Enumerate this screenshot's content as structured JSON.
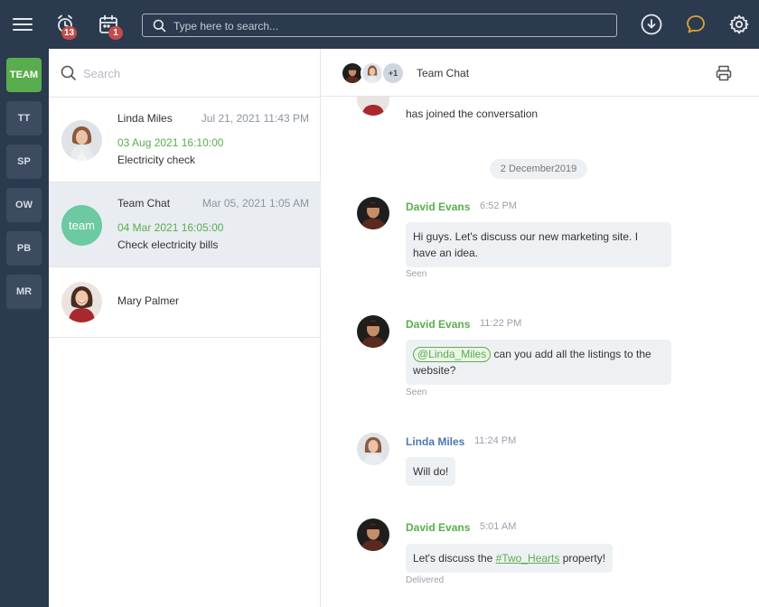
{
  "topbar": {
    "alarm_badge": "13",
    "calendar_badge": "1",
    "search_placeholder": "Type here to search..."
  },
  "rail": {
    "items": [
      {
        "label": "TEAM",
        "active": true
      },
      {
        "label": "TT"
      },
      {
        "label": "SP"
      },
      {
        "label": "OW"
      },
      {
        "label": "PB"
      },
      {
        "label": "MR"
      }
    ]
  },
  "list": {
    "search_placeholder": "Search",
    "conversations": [
      {
        "name": "Linda Miles",
        "time": "Jul 21, 2021 11:43 PM",
        "date": "03 Aug 2021 16:10:00",
        "preview": "Electricity check"
      },
      {
        "name": "Team Chat",
        "time": "Mar 05, 2021 1:05 AM",
        "date": "04 Mar 2021 16:05:00",
        "preview": "Check electricity bills",
        "avatar_text": "team"
      },
      {
        "name": "Mary Palmer"
      }
    ]
  },
  "chat": {
    "title": "Team Chat",
    "extra_members": "+1",
    "join_text": "has joined the conversation",
    "date_divider": "2 December2019",
    "messages": [
      {
        "author": "David Evans",
        "time": "6:52 PM",
        "text_line1": "Hi guys. Let's discuss our new marketing site. I",
        "text_line2": "have an idea.",
        "status": "Seen"
      },
      {
        "author": "David Evans",
        "time": "11:22 PM",
        "mention": "@Linda_Miles",
        "text_after_mention": " can you add all the listings to the",
        "text_line2": "website?",
        "status": "Seen"
      },
      {
        "author": "Linda Miles",
        "time": "11:24 PM",
        "text": "Will do!"
      },
      {
        "author": "David Evans",
        "time": "5:01 AM",
        "text_before": "Let's discuss the ",
        "hashtag": "#Two_Hearts",
        "text_after": " property!",
        "status": "Delivered"
      }
    ]
  },
  "colors": {
    "navy": "#2b3a4e",
    "accent_green": "#5aad4e",
    "badge_red": "#c64b4b",
    "author_blue": "#4a78b5"
  }
}
